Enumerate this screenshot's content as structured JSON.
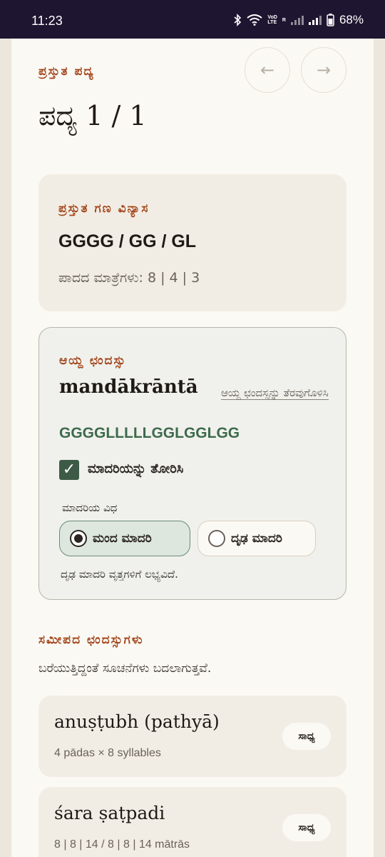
{
  "status_bar": {
    "time": "11:23",
    "volte_line1": "VoD",
    "volte_line2": "LTE",
    "roaming": "R",
    "battery": "68%"
  },
  "verse": {
    "eyebrow": "ಪ್ರಸ್ತುತ ಪದ್ಯ",
    "title": "ಪದ್ಯ 1 / 1",
    "prev_icon": "←",
    "next_icon": "→"
  },
  "gana": {
    "heading": "ಪ್ರಸ್ತುತ ಗಣ ವಿನ್ಯಾಸ",
    "pattern": "GGGG / GG / GL",
    "counts": "ಪಾದದ ಮಾತ್ರೆಗಳು: 8 | 4 | 3"
  },
  "meter": {
    "heading": "ಆಯ್ದ ಛಂದಸ್ಸು",
    "name": "mandākrāntā",
    "open_link": "ಆಯ್ದ ಛಂದಸ್ಸನ್ನು ತೆರವುಗೊಳಿಸಿ",
    "sequence": "GGGGLLLLLGGLGGLGG",
    "checkbox_label": "ಮಾದರಿಯನ್ನು ತೋರಿಸಿ",
    "checkbox_glyph": "✓",
    "style_label": "ಮಾದರಿಯ ವಿಧ",
    "options": [
      "ಮಂದ ಮಾದರಿ",
      "ದೃಢ ಮಾದರಿ"
    ],
    "selected_option": "ಮಂದ ಮಾದರಿ",
    "note": "ದೃಢ ಮಾದರಿ ವೃತ್ತಗಳಿಗೆ ಲಭ್ಯವಿದೆ."
  },
  "nearby": {
    "heading": "ಸಮೀಪದ ಛಂದಸ್ಸುಗಳು",
    "subtitle": "ಬರೆಯುತ್ತಿದ್ದಂತೆ ಸೂಚನೆಗಳು ಬದಲಾಗುತ್ತವೆ.",
    "items": [
      {
        "name": "anuṣṭubh (pathyā)",
        "detail": "4 pādas × 8 syllables",
        "badge": "ಸಾಧ್ಯ"
      },
      {
        "name": "śara ṣaṭpadi",
        "detail": "8 | 8 | 14 / 8 | 8 | 14 mātrās",
        "badge": "ಸಾಧ್ಯ"
      }
    ]
  },
  "colors": {
    "accent": "#a2461c",
    "status_bar": "#1e1530",
    "page_bg": "#fbf9f4",
    "selected_green": "#3d5a46",
    "sequence_green": "#3d6a4c"
  }
}
